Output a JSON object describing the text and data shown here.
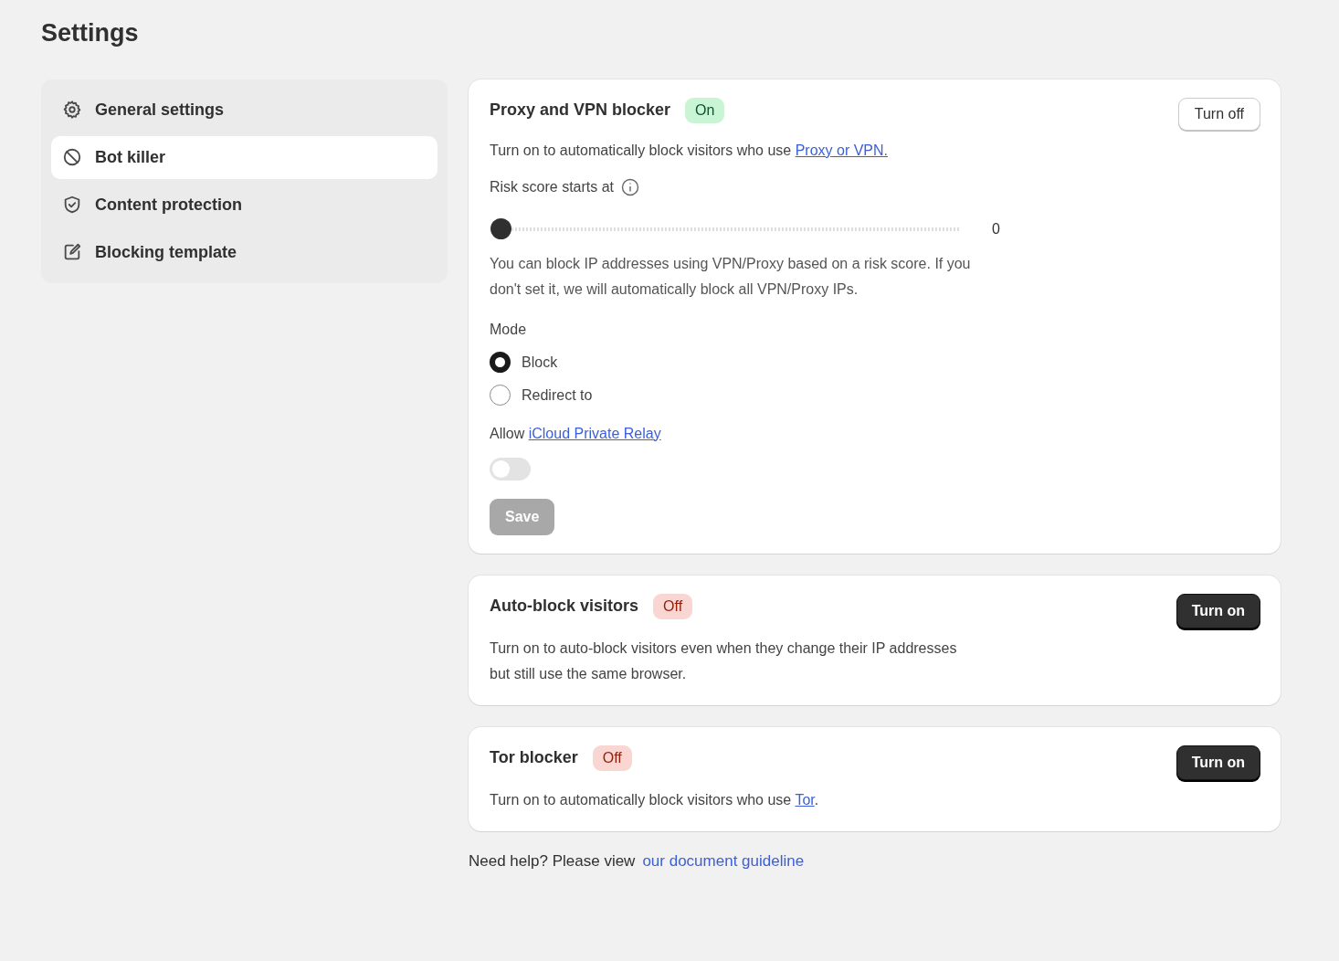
{
  "page": {
    "title": "Settings"
  },
  "sidebar": {
    "items": [
      {
        "label": "General settings",
        "kind": "gear",
        "selected": false
      },
      {
        "label": "Bot killer",
        "kind": "ban",
        "selected": true
      },
      {
        "label": "Content protection",
        "kind": "shield",
        "selected": false
      },
      {
        "label": "Blocking template",
        "kind": "edit",
        "selected": false
      }
    ]
  },
  "cards": [
    {
      "title": "Proxy and VPN blocker",
      "status": {
        "label": "On",
        "on": true
      },
      "button": {
        "label": "Turn off"
      },
      "description": {
        "text": "Turn on to automatically block visitors who use ",
        "link": "Proxy or VPN."
      },
      "risk": {
        "label": "Risk score starts at",
        "level": 0,
        "reading": "0",
        "help": "You can block IP addresses using VPN/Proxy based on a risk score. If you don't set it, we will automatically block all VPN/Proxy IPs."
      },
      "mode": {
        "label": "Mode",
        "options": [
          {
            "label": "Block",
            "selected": true
          },
          {
            "label": "Redirect to",
            "selected": false
          }
        ]
      },
      "relay": {
        "text": "Allow ",
        "link": "iCloud Private Relay",
        "on": false
      },
      "save": {
        "label": "Save",
        "disabled": true
      }
    },
    {
      "title": "Auto-block visitors",
      "status": {
        "label": "Off",
        "on": false
      },
      "button": {
        "label": "Turn on"
      },
      "description": {
        "text": "Turn on to auto-block visitors even when they change their IP addresses but still use the same browser."
      }
    },
    {
      "title": "Tor blocker",
      "status": {
        "label": "Off",
        "on": false
      },
      "button": {
        "label": "Turn on"
      },
      "description": {
        "text": "Turn on to automatically block visitors who use ",
        "link": "Tor",
        "after": "."
      }
    }
  ],
  "footer": {
    "text": "Need help? Please view",
    "link": "our document guideline"
  }
}
